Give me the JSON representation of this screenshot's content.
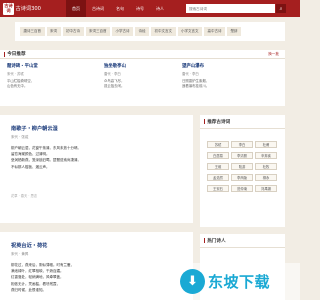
{
  "header": {
    "logo_seal": "古诗\n词",
    "logo_text": "古诗词300",
    "nav": [
      "首页",
      "古诗词",
      "名句",
      "诗号",
      "诗人"
    ],
    "search_placeholder": "搜索古诗词",
    "search_icon": "search-icon"
  },
  "categories": [
    "唐诗三百首",
    "宋词",
    "初中古诗",
    "宋词三百首",
    "小学古诗",
    "诗经",
    "初中文言文",
    "小学文言文",
    "高中古诗",
    "楚辞"
  ],
  "today": {
    "title": "今日推荐",
    "more": "换一批",
    "poems": [
      {
        "title": "题诗碑・平山堂",
        "meta": "宋代 · 苏轼",
        "lines": [
          "平山栏槛倚晴空，",
          "山色有无中。"
        ]
      },
      {
        "title": "独坐敬亭山",
        "meta": "唐代 · 李白",
        "lines": [
          "众鸟高飞尽，",
          "孤云独去闲。"
        ]
      },
      {
        "title": "望庐山瀑布",
        "meta": "唐代 · 李白",
        "lines": [
          "日照香炉生紫烟，",
          "遥看瀑布挂前川。"
        ]
      }
    ]
  },
  "post1": {
    "title": "南歌子・柳户朝云湿",
    "meta": "宋代 · 张镃",
    "lines": [
      "柳户朝云湿，花窗午篆清。东风未放十分晴。",
      "留恋海棠颜色、过清明。",
      "垒润栖新燕，笼深锁旧莺。琵琶弦索尚凄清。",
      "不似那人檀板、遏云声。"
    ],
    "footer": "花草  ·  春天  ·  思念"
  },
  "post2": {
    "title": "祝英台近・荷花",
    "meta": "宋代 · 黄昇",
    "lines": [
      "柳花过，燕来后，阴似薄帷。时有兰雁，",
      "满池绿叶，红翠相映，千娇百媚。",
      "红香落处，轻绡满地，风牵翠盖，",
      "相依无计。凭画槛，看尽残霞，",
      "燕归时候，此恨谁知。",
      "绿窗深处，暗觉凄凉意。"
    ]
  },
  "sidebar": {
    "title": "推荐古诗词",
    "tags": [
      "苏轼",
      "李白",
      "杜甫",
      "白居易",
      "李清照",
      "辛弃疾",
      "王维",
      "陆游",
      "杜牧",
      "孟浩然",
      "李商隐",
      "柳永",
      "王安石",
      "范仲淹",
      "刘禹锡"
    ],
    "title2": "热门诗人"
  },
  "watermark": "东坡下载"
}
